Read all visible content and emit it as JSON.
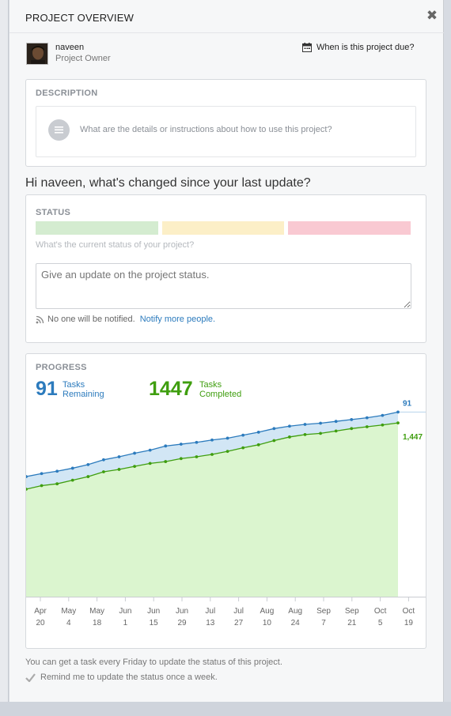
{
  "panel": {
    "title": "PROJECT OVERVIEW",
    "close_icon": "close-icon"
  },
  "owner": {
    "name": "naveen",
    "role": "Project Owner",
    "due_label": "When is this project due?"
  },
  "description": {
    "label": "DESCRIPTION",
    "placeholder": "What are the details or instructions about how to use this project?"
  },
  "greeting": "Hi naveen, what's changed since your last update?",
  "status": {
    "label": "STATUS",
    "colors": [
      "#d4ecd0",
      "#fcefc7",
      "#f9c9d2"
    ],
    "hint": "What's the current status of your project?",
    "input_placeholder": "Give an update on the project status.",
    "notify_text": "No one will be notified.",
    "notify_link": "Notify more people."
  },
  "progress": {
    "label": "PROGRESS",
    "remaining_value": "91",
    "remaining_label_1": "Tasks",
    "remaining_label_2": "Remaining",
    "completed_value": "1447",
    "completed_label_1": "Tasks",
    "completed_label_2": "Completed",
    "remaining_color": "#2c7bbd",
    "completed_color": "#3f9e0f"
  },
  "chart_data": {
    "type": "area",
    "x_ticks": [
      [
        "Apr",
        "20"
      ],
      [
        "May",
        "4"
      ],
      [
        "May",
        "18"
      ],
      [
        "Jun",
        "1"
      ],
      [
        "Jun",
        "15"
      ],
      [
        "Jun",
        "29"
      ],
      [
        "Jul",
        "13"
      ],
      [
        "Jul",
        "27"
      ],
      [
        "Aug",
        "10"
      ],
      [
        "Aug",
        "24"
      ],
      [
        "Sep",
        "7"
      ],
      [
        "Sep",
        "21"
      ],
      [
        "Oct",
        "5"
      ],
      [
        "Oct",
        "19"
      ]
    ],
    "series": [
      {
        "name": "Remaining",
        "color": "#2c7bbd",
        "end_label": "91",
        "values": [
          1000,
          1025,
          1045,
          1070,
          1100,
          1140,
          1165,
          1195,
          1220,
          1255,
          1270,
          1285,
          1305,
          1320,
          1345,
          1370,
          1400,
          1420,
          1435,
          1445,
          1460,
          1475,
          1490,
          1510,
          1538
        ]
      },
      {
        "name": "Completed",
        "color": "#3f9e0f",
        "end_label": "1,447",
        "values": [
          895,
          925,
          940,
          970,
          1000,
          1040,
          1060,
          1085,
          1110,
          1125,
          1150,
          1165,
          1185,
          1210,
          1240,
          1265,
          1300,
          1330,
          1350,
          1360,
          1380,
          1400,
          1415,
          1430,
          1447
        ]
      }
    ],
    "ylim": [
      0,
      1560
    ]
  },
  "footer": {
    "info": "You can get a task every Friday to update the status of this project.",
    "remind": "Remind me to update the status once a week."
  }
}
